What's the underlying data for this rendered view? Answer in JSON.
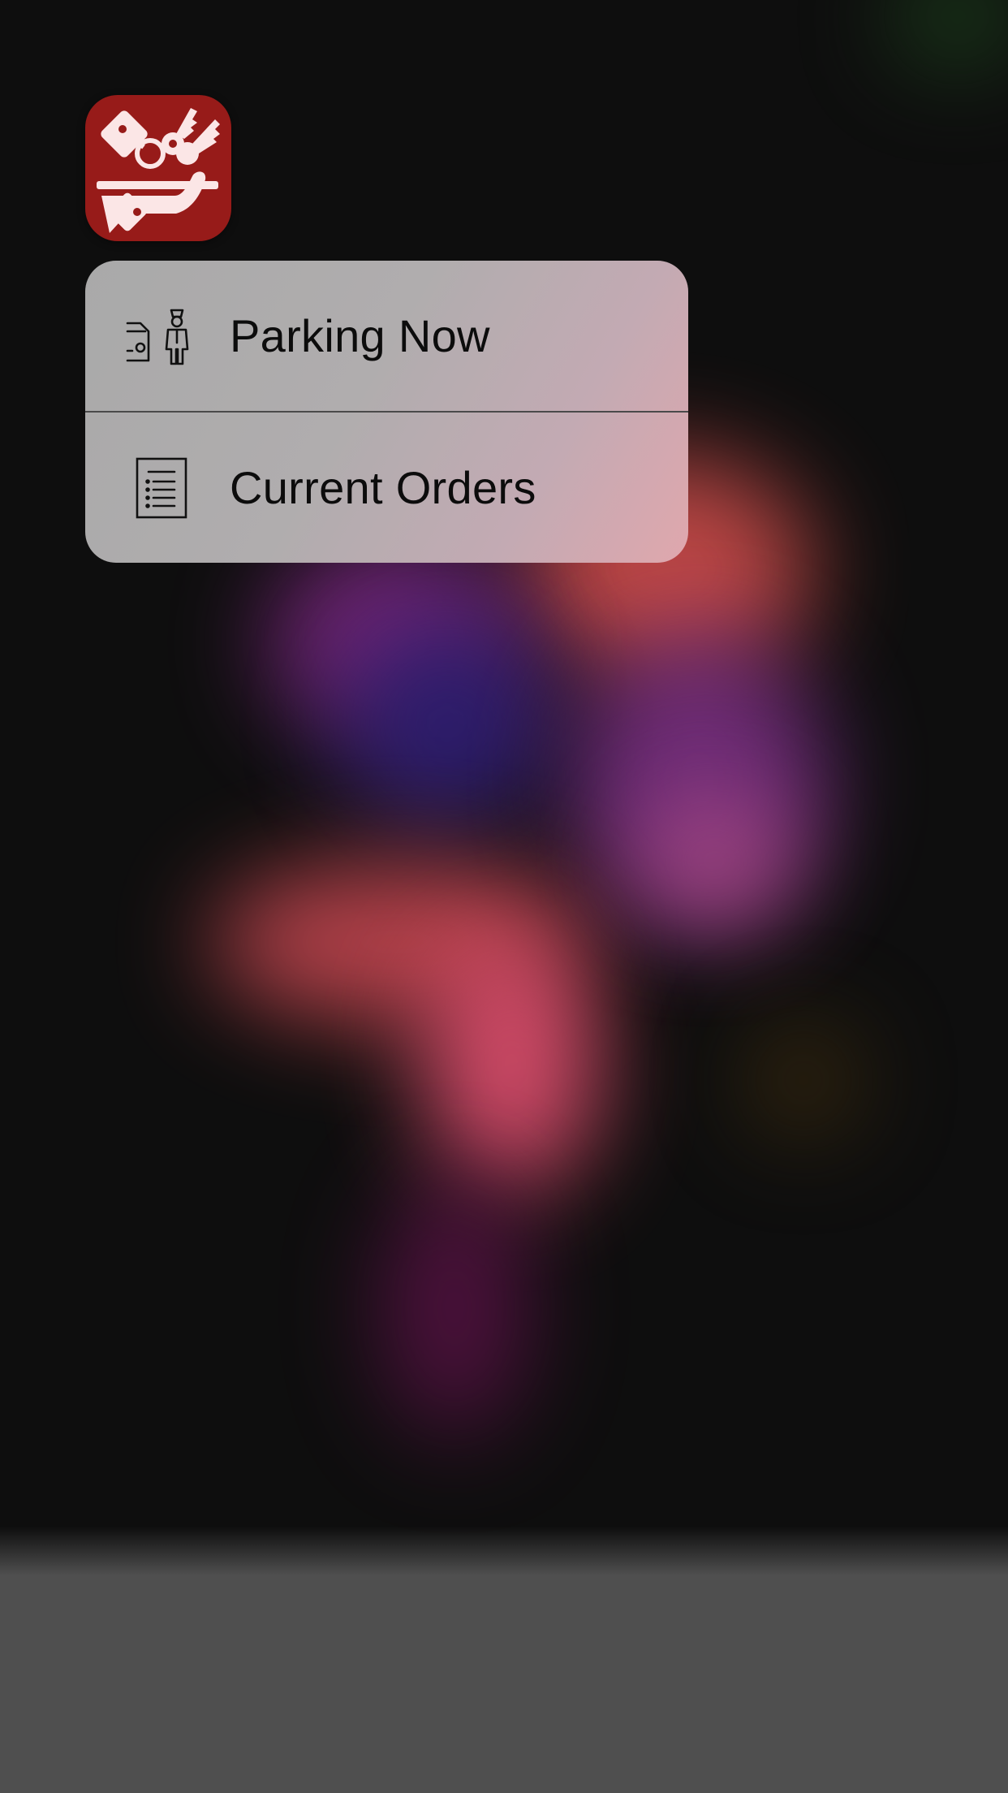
{
  "app": {
    "icon_name": "valet-parking-app-icon",
    "icon_color": "#971b19"
  },
  "quick_actions": [
    {
      "label": "Parking Now",
      "icon": "valet-car-icon"
    },
    {
      "label": "Current Orders",
      "icon": "order-list-icon"
    }
  ]
}
